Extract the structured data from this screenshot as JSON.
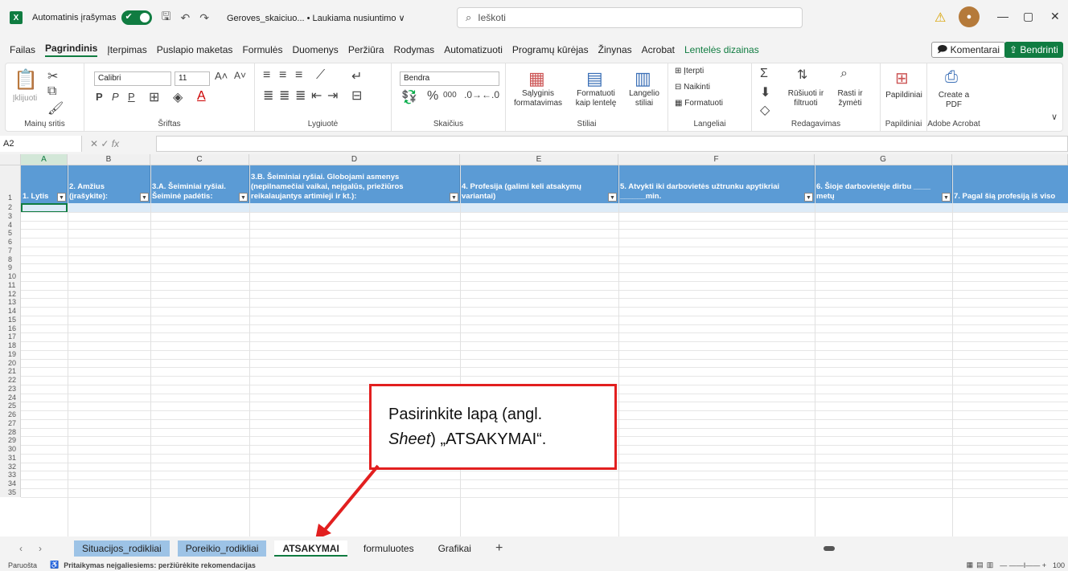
{
  "titlebar": {
    "autosave_label": "Automatinis įrašymas",
    "doc_title": "Geroves_skaiciuo... • Laukiama nusiuntimo ∨",
    "search_placeholder": "Ieškoti"
  },
  "ribbon_tabs": [
    "Failas",
    "Pagrindinis",
    "Įterpimas",
    "Puslapio maketas",
    "Formulės",
    "Duomenys",
    "Peržiūra",
    "Rodymas",
    "Automatizuoti",
    "Programų kūrėjas",
    "Žinynas",
    "Acrobat",
    "Lentelės dizainas"
  ],
  "buttons": {
    "comments": "Komentarai",
    "share": "Bendrinti"
  },
  "ribbon": {
    "paste": "Įklijuoti",
    "font_name": "Calibri",
    "font_size": "11",
    "number_format": "Bendra",
    "conditional": "Sąlyginis formatavimas",
    "format_table": "Formatuoti kaip lentelę",
    "cell_styles": "Langelio stiliai",
    "insert": "Įterpti",
    "delete": "Naikinti",
    "format": "Formatuoti",
    "sort": "Rūšiuoti ir filtruoti",
    "find": "Rasti ir žymėti",
    "addins": "Papildiniai",
    "create_pdf": "Create a PDF",
    "groups": [
      "Mainų sritis",
      "Šriftas",
      "Lygiuotė",
      "Skaičius",
      "Stiliai",
      "Langeliai",
      "Redagavimas",
      "Papildiniai",
      "Adobe Acrobat"
    ]
  },
  "formula_bar": {
    "namebox": "A2",
    "fx": "fx"
  },
  "columns": [
    "A",
    "B",
    "C",
    "D",
    "E",
    "F",
    "G"
  ],
  "headers": [
    "1. Lytis",
    "2. Amžius (įrašykite):",
    "3.A. Šeiminiai ryšiai. Šeiminė padėtis:",
    "3.B. Šeiminiai ryšiai. Globojami asmenys (nepilnamečiai vaikai, neįgalūs, priežiūros reikalaujantys artimieji ir kt.):",
    "4. Profesija (galimi keli atsakymų variantai)",
    "5. Atvykti iki darbovietės užtrunku apytikriai ______min.",
    "6. Šioje darbovietėje dirbu ____ metų",
    "7. Pagal šią profesiją iš viso"
  ],
  "rows": [
    "1",
    "2",
    "3",
    "4",
    "5",
    "6",
    "7",
    "8",
    "9",
    "10",
    "11",
    "12",
    "13",
    "14",
    "15",
    "16",
    "17",
    "18",
    "19",
    "20",
    "21",
    "22",
    "23",
    "24",
    "25",
    "26",
    "27",
    "28",
    "29",
    "30",
    "31",
    "32",
    "33",
    "34",
    "35"
  ],
  "callout": {
    "line1": "Pasirinkite lapą (angl.",
    "line2_italic": "Sheet",
    "line2_rest": ") „ATSAKYMAI“."
  },
  "sheets": [
    "Situacijos_rodikliai",
    "Poreikio_rodikliai",
    "ATSAKYMAI",
    "formuluotes",
    "Grafikai"
  ],
  "status": {
    "ready": "Paruošta",
    "accessibility": "Pritaikymas neįgaliesiems: peržiūrėkite rekomendacijas",
    "zoom": "100"
  }
}
